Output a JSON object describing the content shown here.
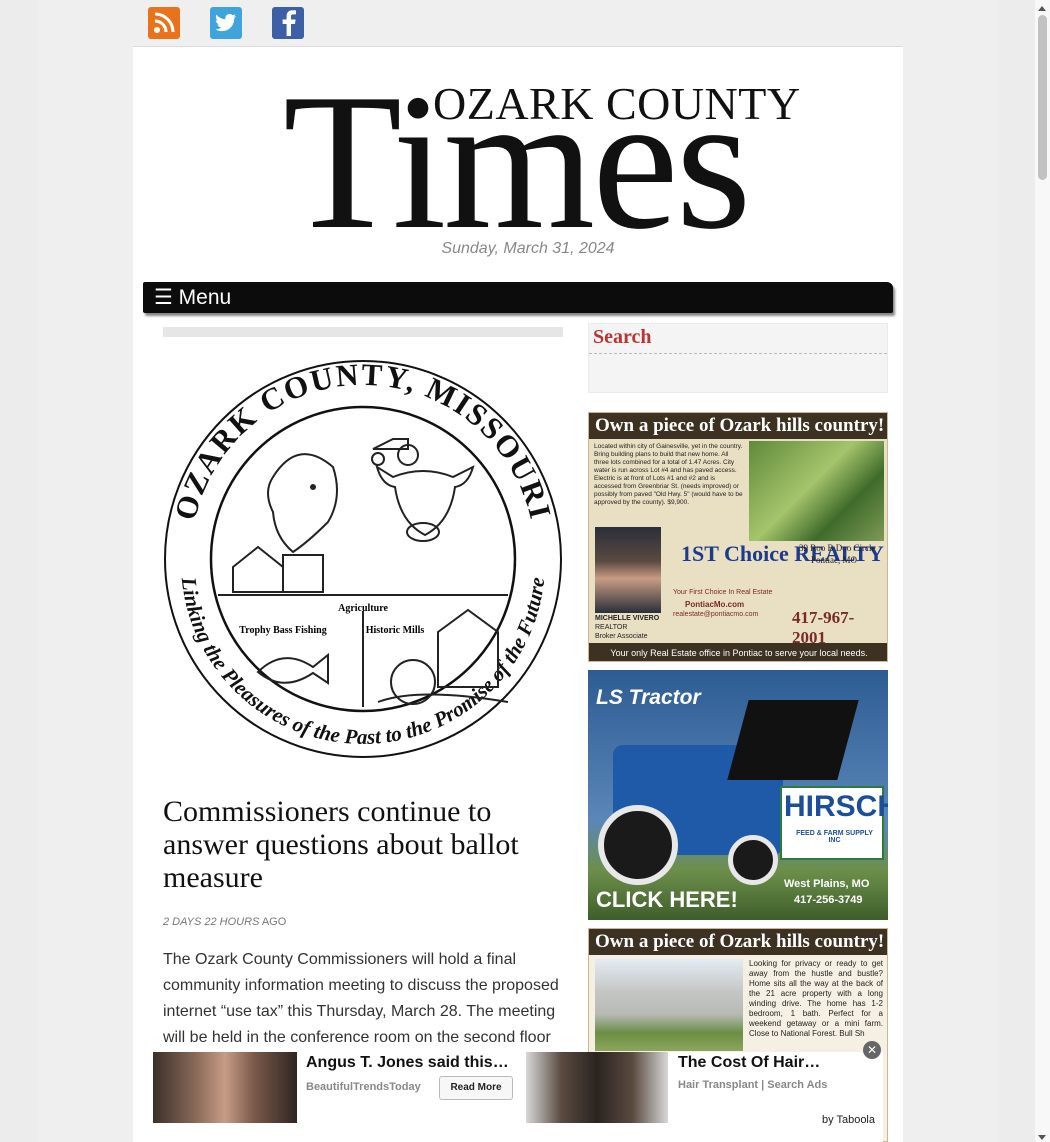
{
  "social": {
    "rss_icon": "rss-icon",
    "twitter_icon": "twitter-icon",
    "facebook_icon": "facebook-icon"
  },
  "masthead": {
    "county": "OZARK COUNTY",
    "times": "Times",
    "date": "Sunday, March 31, 2024"
  },
  "nav": {
    "menu_label": "☰ Menu"
  },
  "article": {
    "seal": {
      "top_text": "OZARK COUNTY, MISSOURI",
      "bottom_text": "Linking the Pleasures of the Past to the Promise of the Future",
      "label_agriculture": "Agriculture",
      "label_fishing": "Trophy Bass Fishing",
      "label_mills": "Historic Mills"
    },
    "headline": "Commissioners continue to answer questions about ballot measure",
    "time_ago": "2 DAYS 22 HOURS",
    "ago": "AGO",
    "body": "The Ozark County Commissioners will hold a final community information meeting to discuss the proposed internet “use tax” this Thursday, March 28. The meeting will be held in the conference room on the second floor"
  },
  "sidebar": {
    "search_title": "Search",
    "ad1": {
      "headline": "Own a piece of Ozark hills country!",
      "description": "Located within city of Gainesville, yet in the country. Bring building plans to build that new home. All three lots combined for a total of 1.47 Acres. City water is run across Lot #4 and has paved access. Electric is at front of Lots #1 and #2 and is accessed from Greenbriar St. (needs improved) or possibly from paved \"Old Hwy. 5\" (would have to be approved by the county). $9,900.",
      "brand": "1ST Choice REALTY",
      "tagline": "Your First Choice In Real Estate",
      "website": "PontiacMo.com",
      "email": "realestate@pontiacmo.com",
      "agent_name": "MICHELLE VIVERO",
      "agent_title": "REALTOR",
      "agent_role": "Broker Associate",
      "address": "39 Roo B Doo Circle",
      "city": "Pontiac, MO",
      "phone": "417-967-2001",
      "footer": "Your only Real Estate office in Pontiac to serve your local needs."
    },
    "ad2": {
      "brand": "LS Tractor",
      "dealer": "HIRSCH",
      "dealer_sub": "FEED & FARM SUPPLY INC",
      "cta": "CLICK HERE!",
      "city": "West Plains, MO",
      "phone": "417-256-3749"
    },
    "ad3": {
      "headline": "Own a piece of Ozark hills country!",
      "description": "Looking for privacy or ready to get away from the hustle and bustle? Home sits all the way at the back of the 21 acre property with a long winding drive. The home has 1-2 bedroom, 1 bath. Perfect for a weekend getaway or a mini farm. Close to National Forest. Bull Sh"
    }
  },
  "taboola": {
    "item1_title": "Angus T. Jones said this…",
    "item1_source": "BeautifulTrendsToday",
    "item1_button": "Read More",
    "item2_title": "The Cost Of Hair…",
    "item2_source": "Hair Transplant | Search Ads",
    "by": "by Taboola",
    "close": "✕"
  }
}
